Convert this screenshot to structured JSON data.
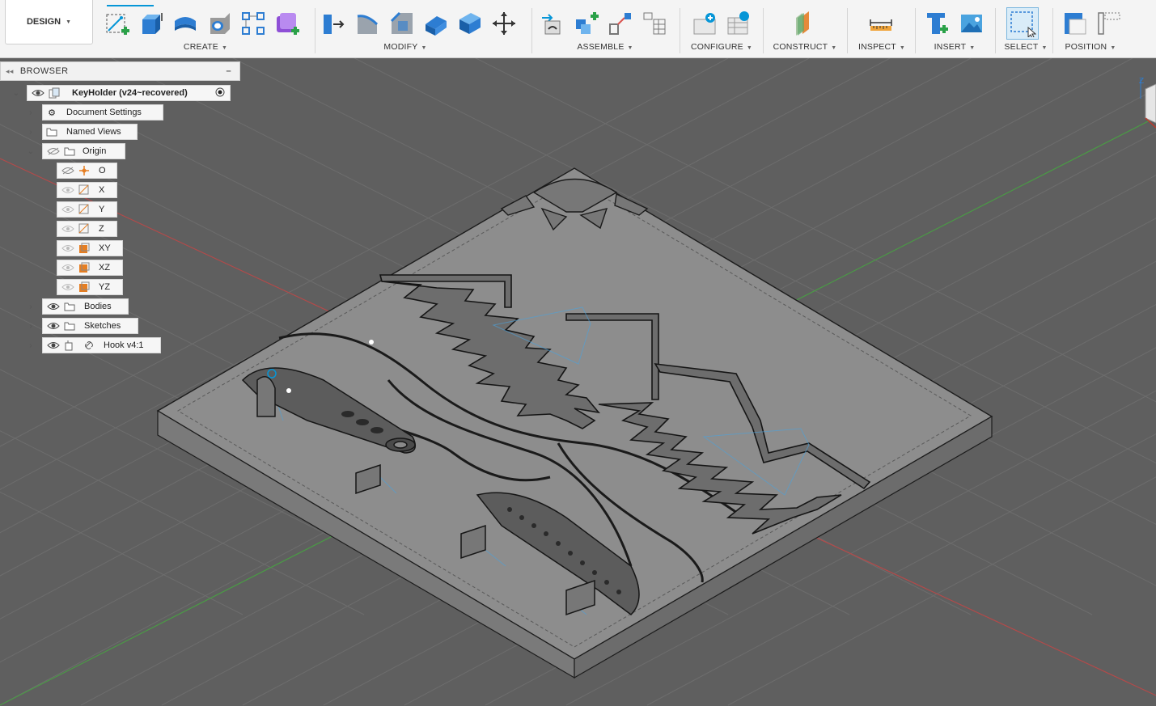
{
  "workspace": {
    "label": "DESIGN"
  },
  "toolbar": {
    "groups": [
      {
        "label": "CREATE"
      },
      {
        "label": "MODIFY"
      },
      {
        "label": "ASSEMBLE"
      },
      {
        "label": "CONFIGURE"
      },
      {
        "label": "CONSTRUCT"
      },
      {
        "label": "INSPECT"
      },
      {
        "label": "INSERT"
      },
      {
        "label": "SELECT"
      },
      {
        "label": "POSITION"
      }
    ]
  },
  "browser": {
    "title": "BROWSER",
    "root": "KeyHolder (v24~recovered)",
    "items": [
      {
        "label": "Document Settings"
      },
      {
        "label": "Named Views"
      },
      {
        "label": "Origin"
      },
      {
        "label": "O"
      },
      {
        "label": "X"
      },
      {
        "label": "Y"
      },
      {
        "label": "Z"
      },
      {
        "label": "XY"
      },
      {
        "label": "XZ"
      },
      {
        "label": "YZ"
      },
      {
        "label": "Bodies"
      },
      {
        "label": "Sketches"
      },
      {
        "label": "Hook v4:1"
      }
    ]
  },
  "viewcube": {
    "axis": "Z"
  },
  "colors": {
    "accent": "#0696d7",
    "model": "#8a8a8a"
  }
}
